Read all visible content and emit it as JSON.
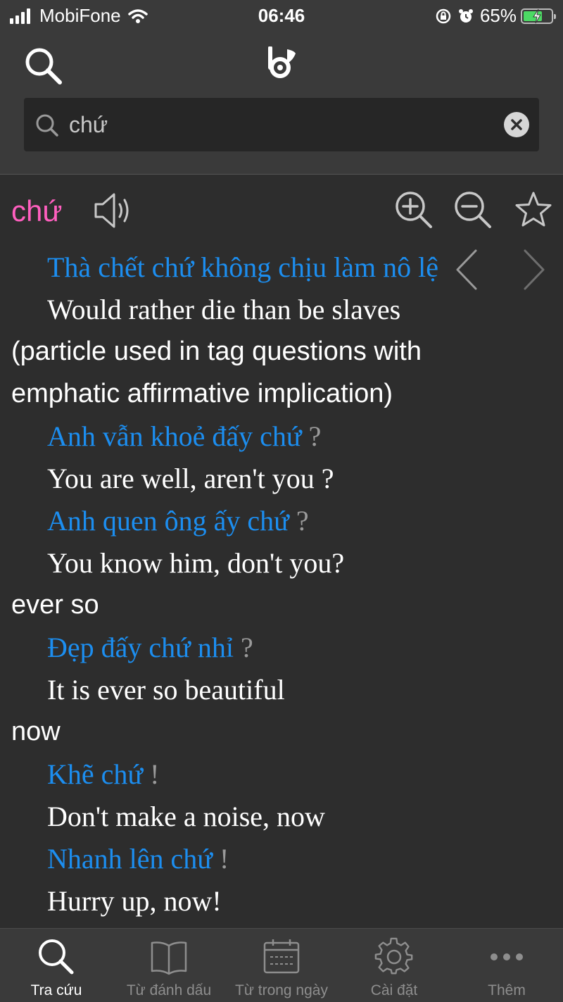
{
  "status": {
    "carrier": "MobiFone",
    "time": "06:46",
    "battery": "65%"
  },
  "search": {
    "value": "chứ",
    "placeholder": ""
  },
  "word": {
    "title": "chứ"
  },
  "entries": [
    {
      "type": "example",
      "vi": "Thà chết chứ không chịu làm nô lệ",
      "punct": ""
    },
    {
      "type": "translation",
      "text": "Would rather die than be slaves"
    },
    {
      "type": "definition",
      "text": "(particle used in tag questions with"
    },
    {
      "type": "definition",
      "text": "emphatic affirmative implication)"
    },
    {
      "type": "example",
      "vi": "Anh vẫn khoẻ đấy chứ",
      "punct": " ?"
    },
    {
      "type": "translation",
      "text": "You are well, aren't you ?"
    },
    {
      "type": "example",
      "vi": "Anh quen ông ấy chứ",
      "punct": " ?"
    },
    {
      "type": "translation",
      "text": "You know him, don't you?"
    },
    {
      "type": "definition",
      "text": "ever so"
    },
    {
      "type": "example",
      "vi": "Đẹp đấy chứ nhỉ",
      "punct": " ?"
    },
    {
      "type": "translation",
      "text": "It is ever so beautiful"
    },
    {
      "type": "definition",
      "text": "now"
    },
    {
      "type": "example",
      "vi": "Khẽ chứ",
      "punct": " !"
    },
    {
      "type": "translation",
      "text": "Don't make a noise, now"
    },
    {
      "type": "example",
      "vi": "Nhanh lên chứ",
      "punct": " !"
    },
    {
      "type": "translation",
      "text": "Hurry up, now!"
    }
  ],
  "icons": {
    "header_search": "search-icon",
    "logo": "app-logo-icon",
    "speaker": "speaker-icon",
    "zoom_in": "zoom-in-icon",
    "zoom_out": "zoom-out-icon",
    "bookmark": "star-icon",
    "prev": "chevron-left-icon",
    "next": "chevron-right-icon"
  },
  "tabs": [
    {
      "label": "Tra cứu",
      "icon": "search-icon",
      "active": true
    },
    {
      "label": "Từ đánh dấu",
      "icon": "book-icon",
      "active": false
    },
    {
      "label": "Từ trong ngày",
      "icon": "calendar-icon",
      "active": false
    },
    {
      "label": "Cài đặt",
      "icon": "gear-icon",
      "active": false
    },
    {
      "label": "Thêm",
      "icon": "more-icon",
      "active": false
    }
  ],
  "colors": {
    "background": "#2d2d2d",
    "header": "#3a3a3a",
    "word_title": "#ff5fbf",
    "example": "#1c8ef0",
    "text": "#ffffff",
    "battery_fill": "#4cd964"
  }
}
